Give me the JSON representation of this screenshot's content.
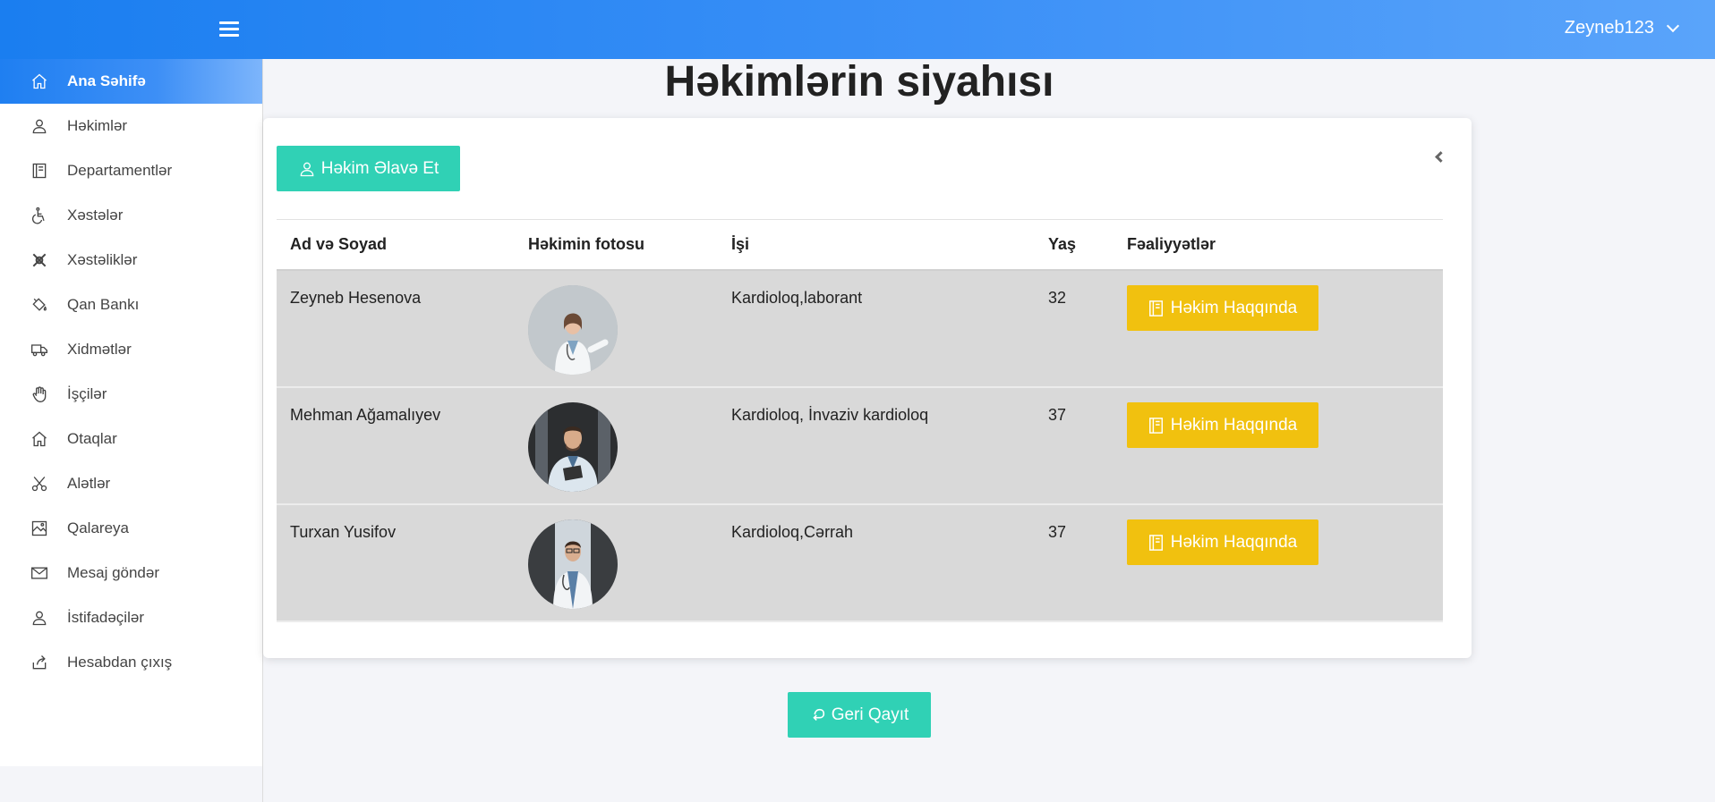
{
  "header": {
    "username": "Zeyneb123"
  },
  "sidebar": {
    "items": [
      {
        "label": "Ana Səhifə",
        "icon": "home-icon",
        "active": true
      },
      {
        "label": "Həkimlər",
        "icon": "user-icon"
      },
      {
        "label": "Departamentlər",
        "icon": "book-icon"
      },
      {
        "label": "Xəstələr",
        "icon": "wheelchair-icon"
      },
      {
        "label": "Xəstəliklər",
        "icon": "virus-icon"
      },
      {
        "label": "Qan Bankı",
        "icon": "paint-bucket-icon"
      },
      {
        "label": "Xidmətlər",
        "icon": "truck-icon"
      },
      {
        "label": "İşçilər",
        "icon": "hand-icon"
      },
      {
        "label": "Otaqlar",
        "icon": "home-icon"
      },
      {
        "label": "Alətlər",
        "icon": "scissors-icon"
      },
      {
        "label": "Qalareya",
        "icon": "gallery-icon"
      },
      {
        "label": "Mesaj göndər",
        "icon": "mail-icon"
      },
      {
        "label": "İstifadəçilər",
        "icon": "user-icon"
      },
      {
        "label": "Hesabdan çıxış",
        "icon": "logout-icon"
      }
    ]
  },
  "main": {
    "title": "Həkimlərin siyahısı",
    "add_button": "Həkim Əlavə Et",
    "back_button": "Geri Qayıt",
    "table": {
      "headers": [
        "Ad və Soyad",
        "Həkimin fotosu",
        "İşi",
        "Yaş",
        "Fəaliyyətlər"
      ],
      "rows": [
        {
          "name": "Zeyneb Hesenova",
          "job": "Kardioloq,laborant",
          "age": "32",
          "action": "Həkim Haqqında"
        },
        {
          "name": "Mehman Ağamalıyev",
          "job": "Kardioloq, İnvaziv kardioloq",
          "age": "37",
          "action": "Həkim Haqqında"
        },
        {
          "name": "Turxan Yusifov",
          "job": "Kardioloq,Cərrah",
          "age": "37",
          "action": "Həkim Haqqında"
        }
      ]
    }
  },
  "colors": {
    "topbar": "#1a7ef0",
    "teal_button": "#30d1b5",
    "yellow_button": "#f1c10f",
    "row_bg": "#d9d9d9"
  }
}
